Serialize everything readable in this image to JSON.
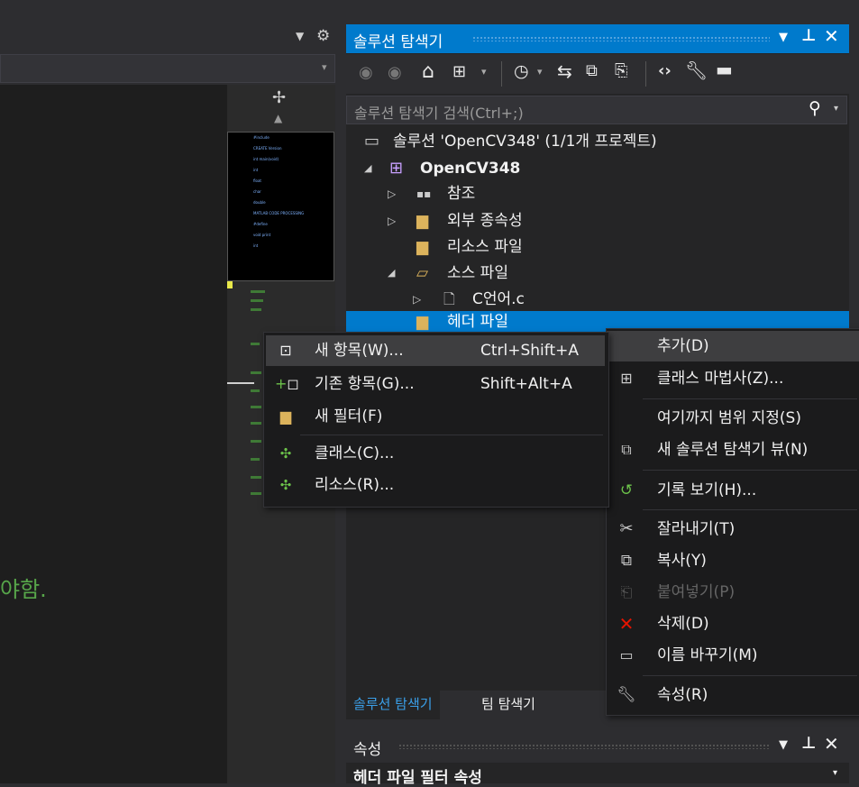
{
  "editor": {
    "green_text": "야함.",
    "minimap_lines": [
      "#include",
      "CREATE Version",
      "int main(void)",
      "int",
      "float",
      "char",
      "double",
      "MATLAB CODE PROCESSING",
      "#define",
      "void print",
      "int"
    ]
  },
  "solution_explorer": {
    "title": "솔루션 탐색기",
    "search_placeholder": "솔루션 탐색기 검색(Ctrl+;)",
    "tree": {
      "solution": "솔루션 'OpenCV348' (1/1개 프로젝트)",
      "project": "OpenCV348",
      "references": "참조",
      "external_deps": "외부 종속성",
      "resource_files": "리소스 파일",
      "source_files": "소스 파일",
      "source_c": "C언어.c",
      "header_files": "헤더 파일"
    },
    "tabs": [
      "솔루션 탐색기",
      "팀 탐색기"
    ]
  },
  "properties": {
    "title": "속성",
    "subject": "헤더 파일 필터 속성"
  },
  "submenu": {
    "items": [
      {
        "label": "새 항목(W)...",
        "shortcut": "Ctrl+Shift+A"
      },
      {
        "label": "기존 항목(G)...",
        "shortcut": "Shift+Alt+A"
      },
      {
        "label": "새 필터(F)",
        "shortcut": ""
      },
      {
        "label": "클래스(C)...",
        "shortcut": ""
      },
      {
        "label": "리소스(R)...",
        "shortcut": ""
      }
    ]
  },
  "context_menu": {
    "items": [
      {
        "label": "추가(D)"
      },
      {
        "label": "클래스 마법사(Z)..."
      },
      {
        "label": "여기까지 범위 지정(S)"
      },
      {
        "label": "새 솔루션 탐색기 뷰(N)"
      },
      {
        "label": "기록 보기(H)..."
      },
      {
        "label": "잘라내기(T)"
      },
      {
        "label": "복사(Y)"
      },
      {
        "label": "붙여넣기(P)"
      },
      {
        "label": "삭제(D)"
      },
      {
        "label": "이름 바꾸기(M)"
      },
      {
        "label": "속성(R)"
      }
    ]
  },
  "colors": {
    "accent": "#007acc",
    "green_comment": "#57a64a",
    "delete_red": "#e51400"
  }
}
